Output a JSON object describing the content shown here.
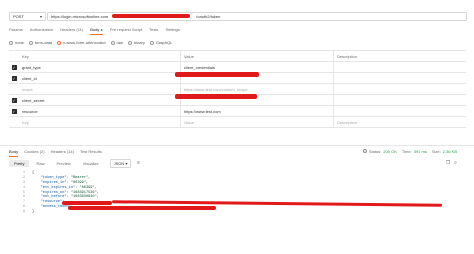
{
  "request": {
    "method": "POST",
    "url_prefix": "https://login.microsoftonline.com",
    "url_suffix": "/oauth2/token"
  },
  "tabs": [
    {
      "label": "Params"
    },
    {
      "label": "Authorization"
    },
    {
      "label": "Headers (11)"
    },
    {
      "label": "Body",
      "active": true,
      "dot": "●"
    },
    {
      "label": "Pre-request Script"
    },
    {
      "label": "Tests"
    },
    {
      "label": "Settings"
    }
  ],
  "body_types": [
    {
      "label": "none"
    },
    {
      "label": "form-data"
    },
    {
      "label": "x-www-form-urlencoded",
      "selected": true
    },
    {
      "label": "raw"
    },
    {
      "label": "binary"
    },
    {
      "label": "GraphQL"
    }
  ],
  "params_table": {
    "headers": {
      "key": "Key",
      "value": "Value",
      "description": "Description"
    },
    "rows": [
      {
        "checked": true,
        "key": "grant_type",
        "value": "client_credentials"
      },
      {
        "checked": true,
        "key": "client_id",
        "value": ""
      },
      {
        "checked": false,
        "key": "scope",
        "value": "https://www.test.com/custom_scope"
      },
      {
        "checked": true,
        "key": "client_secret",
        "value": ""
      },
      {
        "checked": true,
        "key": "resource",
        "value": "https://www.test.com"
      }
    ],
    "placeholder": {
      "key": "Key",
      "value": "Value",
      "description": "Description"
    }
  },
  "response": {
    "tabs": [
      {
        "label": "Body",
        "active": true
      },
      {
        "label": "Cookies (2)"
      },
      {
        "label": "Headers (14)"
      },
      {
        "label": "Test Results"
      }
    ],
    "status_label": "Status:",
    "status_value": "200 OK",
    "time_label": "Time:",
    "time_value": "391 ms",
    "size_label": "Size:",
    "size_value": "2.36 KB",
    "views": [
      {
        "label": "Pretty",
        "active": true
      },
      {
        "label": "Raw"
      },
      {
        "label": "Preview"
      },
      {
        "label": "Visualize"
      }
    ],
    "format": "JSON",
    "code_lines": [
      {
        "n": "1",
        "text": "{"
      },
      {
        "n": "2",
        "key": "\"token_type\"",
        "val": "\"Bearer\","
      },
      {
        "n": "3",
        "key": "\"expires_in\"",
        "val": "\"86399\","
      },
      {
        "n": "4",
        "key": "\"ext_expires_in\"",
        "val": "\"86399\","
      },
      {
        "n": "5",
        "key": "\"expires_on\"",
        "val": "\"1683917536\","
      },
      {
        "n": "6",
        "key": "\"not_before\"",
        "val": "\"1683830840\","
      },
      {
        "n": "7",
        "key": "\"resource\"",
        "val": ""
      },
      {
        "n": "8",
        "key": "\"access_token\"",
        "val": ""
      },
      {
        "n": "9",
        "text": "}"
      }
    ]
  },
  "icons": {
    "method_dropdown": "chevron-down-icon",
    "globe": "globe-icon",
    "wrap": "wrap-lines-icon",
    "copy": "copy-icon",
    "search": "search-icon"
  },
  "colors": {
    "accent": "#ff6c37",
    "redaction": "#e01a1a",
    "status_ok": "#24a148"
  }
}
